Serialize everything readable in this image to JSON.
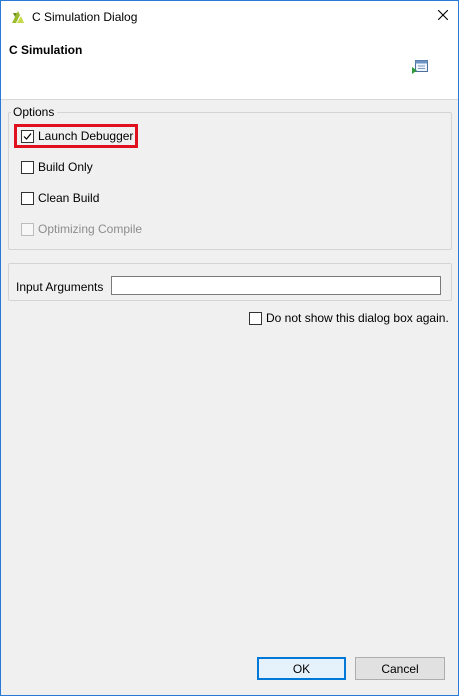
{
  "window": {
    "title": "C Simulation Dialog"
  },
  "header": {
    "title": "C Simulation"
  },
  "options": {
    "legend": "Options",
    "items": [
      {
        "label": "Launch Debugger",
        "checked": true,
        "enabled": true,
        "highlighted": true
      },
      {
        "label": "Build Only",
        "checked": false,
        "enabled": true
      },
      {
        "label": "Clean Build",
        "checked": false,
        "enabled": true
      },
      {
        "label": "Optimizing Compile",
        "checked": false,
        "enabled": false
      }
    ]
  },
  "input_arguments": {
    "label": "Input Arguments",
    "value": ""
  },
  "dont_show": {
    "label": "Do not show this dialog box again.",
    "checked": false
  },
  "buttons": {
    "ok": "OK",
    "cancel": "Cancel"
  },
  "colors": {
    "highlight": "#e0101f",
    "window_border": "#2b79d7",
    "default_button_border": "#0078d7"
  }
}
